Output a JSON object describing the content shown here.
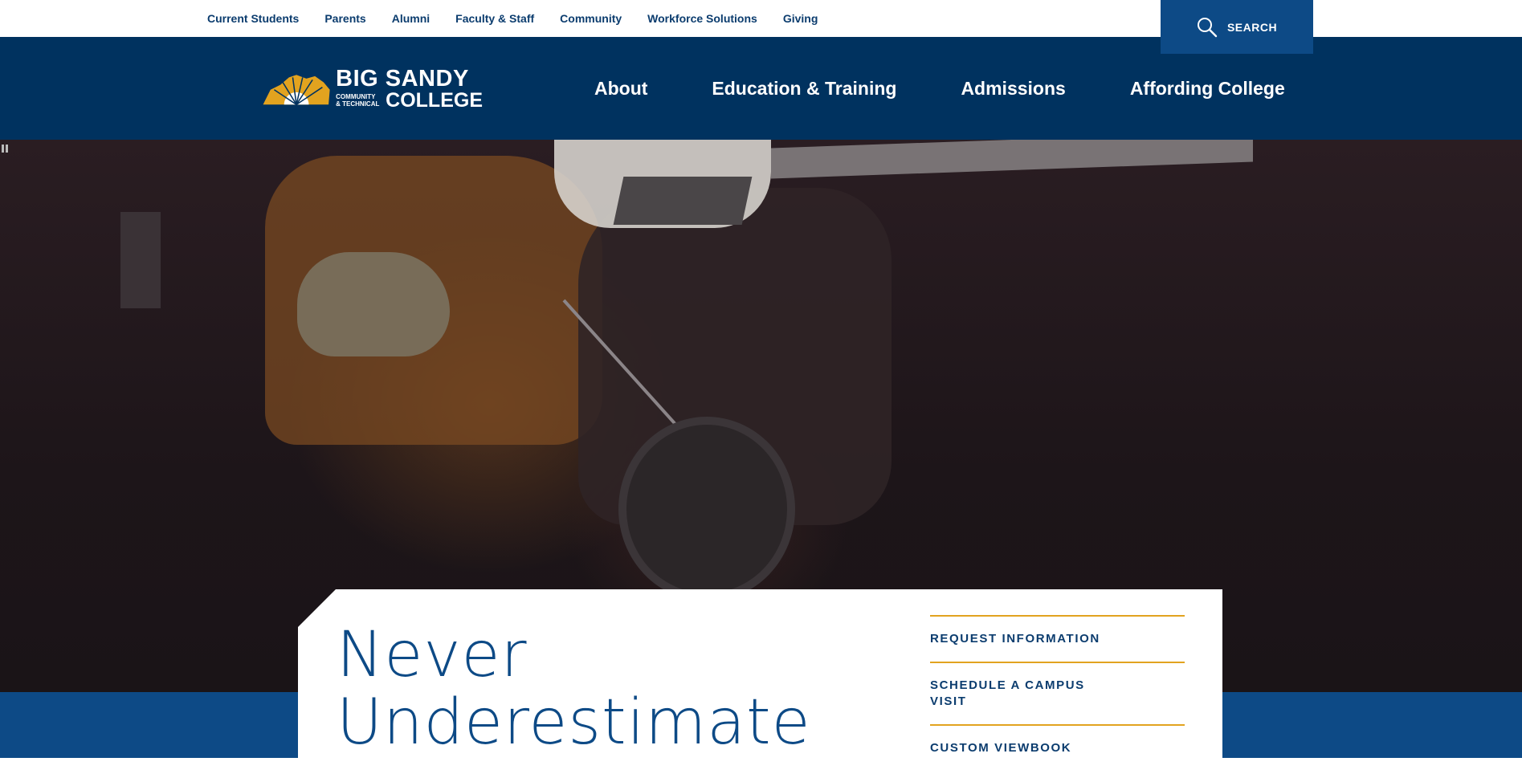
{
  "utility_nav": {
    "items": [
      "Current Students",
      "Parents",
      "Alumni",
      "Faculty & Staff",
      "Community",
      "Workforce Solutions",
      "Giving"
    ],
    "search_label": "SEARCH"
  },
  "logo": {
    "line1": "BIG SANDY",
    "line2a": "COMMUNITY",
    "line2b": "& TECHNICAL",
    "line3": "COLLEGE"
  },
  "main_nav": {
    "items": [
      "About",
      "Education & Training",
      "Admissions",
      "Affording College"
    ]
  },
  "hero": {
    "headline_line1": "Never",
    "headline_line2": "Underestimate"
  },
  "cta": {
    "items": [
      "REQUEST INFORMATION",
      "SCHEDULE A CAMPUS VISIT",
      "CUSTOM VIEWBOOK"
    ]
  },
  "colors": {
    "utility_bg": "#ffffff",
    "nav_bg": "#00325f",
    "accent_blue": "#0d4a86",
    "accent_gold": "#e2a31f",
    "text_navy": "#0b3c6e"
  },
  "icons": [
    "search-icon",
    "pause-icon",
    "logo-sun-icon"
  ]
}
